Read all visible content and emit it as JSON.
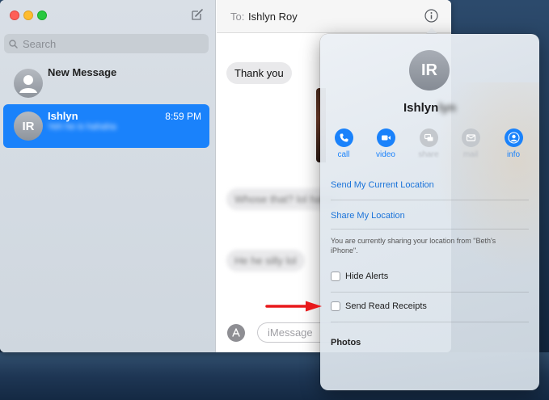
{
  "sidebar": {
    "search_placeholder": "Search",
    "conversations": [
      {
        "name": "New Message",
        "selected": false
      },
      {
        "name": "Ishlyn",
        "initials": "IR",
        "time": "8:59 PM",
        "preview": "Yeh he is hahaha",
        "selected": true
      }
    ]
  },
  "chat": {
    "to_label": "To:",
    "recipient": "Ishlyn Roy",
    "messages": [
      {
        "text": "Thank you",
        "blurred": false
      },
      {
        "text": "Whose that? lol haha",
        "blurred": true
      },
      {
        "text": "He he silly lol",
        "blurred": true
      }
    ],
    "input_placeholder": "iMessage"
  },
  "details": {
    "initials": "IR",
    "name": "Ishlyn",
    "name_blurred": "lyn",
    "actions": [
      {
        "label": "call",
        "icon": "phone-icon",
        "enabled": true
      },
      {
        "label": "video",
        "icon": "video-icon",
        "enabled": true
      },
      {
        "label": "share",
        "icon": "share-screen-icon",
        "enabled": false
      },
      {
        "label": "mail",
        "icon": "mail-icon",
        "enabled": false
      },
      {
        "label": "info",
        "icon": "person-icon",
        "enabled": true
      }
    ],
    "send_location": "Send My Current Location",
    "share_location": "Share My Location",
    "sharing_note": "You are currently sharing your location from \"Beth's iPhone\".",
    "hide_alerts": "Hide Alerts",
    "read_receipts": "Send Read Receipts",
    "photos_title": "Photos"
  },
  "colors": {
    "accent": "#1a82fb",
    "annotation_arrow": "#e8191b"
  }
}
